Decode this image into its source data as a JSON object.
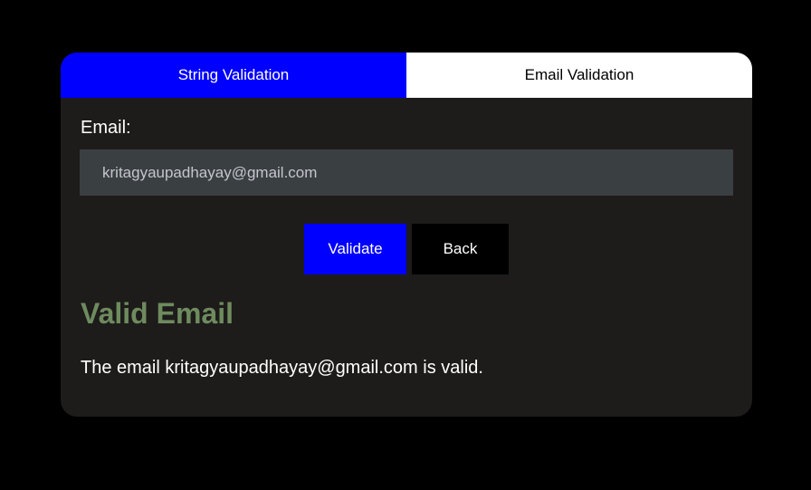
{
  "tabs": [
    {
      "label": "String Validation",
      "active": true
    },
    {
      "label": "Email Validation",
      "active": false
    }
  ],
  "form": {
    "email_label": "Email:",
    "email_value": "kritagyaupadhayay@gmail.com"
  },
  "buttons": {
    "validate_label": "Validate",
    "back_label": "Back"
  },
  "result": {
    "title": "Valid Email",
    "message": "The email kritagyaupadhayay@gmail.com is valid."
  },
  "colors": {
    "background": "#000000",
    "card": "#1e1b1b",
    "accent": "#0000ff",
    "input_bg": "#3a3f42",
    "success_text": "#6e8b5e"
  }
}
